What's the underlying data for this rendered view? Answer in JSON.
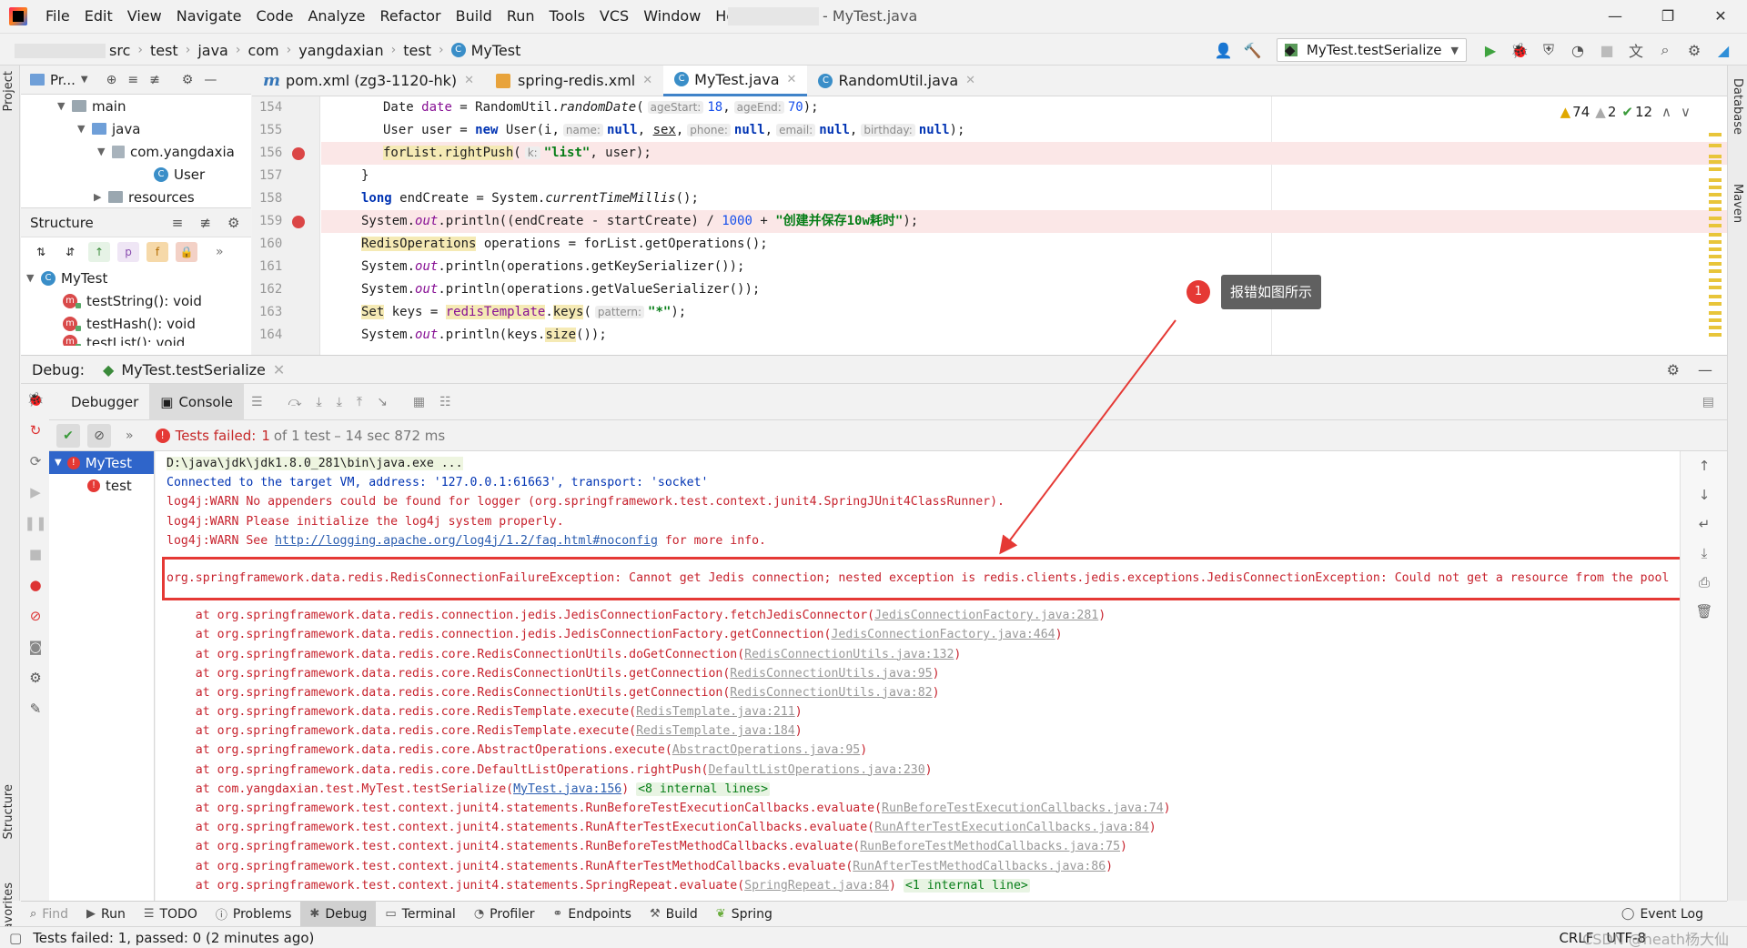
{
  "app": {
    "window_title": "- MyTest.java",
    "menu": [
      "File",
      "Edit",
      "View",
      "Navigate",
      "Code",
      "Analyze",
      "Refactor",
      "Build",
      "Run",
      "Tools",
      "VCS",
      "Window",
      "Help"
    ],
    "window_controls": [
      "—",
      "❐",
      "✕"
    ]
  },
  "breadcrumb": [
    "src",
    "test",
    "java",
    "com",
    "yangdaxian",
    "test",
    "MyTest"
  ],
  "toolbar": {
    "run_config": "MyTest.testSerialize"
  },
  "left_strip": {
    "project": "Project",
    "structure": "Structure",
    "favorites": "Favorites"
  },
  "right_strip": {
    "database": "Database",
    "maven": "Maven"
  },
  "project_panel": {
    "title": "Pr...",
    "tree": [
      {
        "label": "main",
        "level": 2,
        "type": "folder"
      },
      {
        "label": "java",
        "level": 3,
        "type": "folder-blue"
      },
      {
        "label": "com.yangdaxia",
        "level": 4,
        "type": "package"
      },
      {
        "label": "User",
        "level": 5,
        "type": "class"
      },
      {
        "label": "resources",
        "level": 3,
        "type": "folder"
      }
    ]
  },
  "structure_panel": {
    "title": "Structure",
    "root": "MyTest",
    "items": [
      "testString(): void",
      "testHash(): void",
      "testList(): void"
    ]
  },
  "editor_tabs": [
    {
      "label": "pom.xml (zg3-1120-hk)",
      "icon": "maven-icon",
      "active": false
    },
    {
      "label": "spring-redis.xml",
      "icon": "xml-icon",
      "active": false
    },
    {
      "label": "MyTest.java",
      "icon": "class-icon",
      "active": true
    },
    {
      "label": "RandomUtil.java",
      "icon": "class-icon",
      "active": false
    }
  ],
  "editor": {
    "line_numbers": [
      "154",
      "155",
      "156",
      "157",
      "158",
      "159",
      "160",
      "161",
      "162",
      "163",
      "164"
    ],
    "inspections": {
      "warnings": "74",
      "weak_warnings": "2",
      "ok": "12"
    },
    "code": {
      "l154": {
        "a": "Date ",
        "b": "date",
        "c": " = RandomUtil.",
        "d": "randomDate",
        "e": "(",
        "h1": "ageStart:",
        "v1": "18",
        "f": ",",
        "h2": "ageEnd:",
        "v2": "70",
        "g": ");"
      },
      "l155": {
        "a": "User user = ",
        "kw": "new",
        "b": " User(i,",
        "h1": "name:",
        "n1": "null",
        "c": ",",
        "sex": "sex",
        "d": ",",
        "h2": "phone:",
        "n2": "null",
        "e": ",",
        "h3": "email:",
        "n3": "null",
        "f": ",",
        "h4": "birthday:",
        "n4": "null",
        "g": ");"
      },
      "l156": {
        "a": "forList.rightPush",
        "b": "(",
        "h1": "k:",
        "s": "\"list\"",
        "c": ", user);"
      },
      "l157": {
        "a": "}"
      },
      "l158": {
        "kw": "long",
        "a": " endCreate = System.",
        "b": "currentTimeMillis",
        "c": "();"
      },
      "l159": {
        "a": "System.",
        "out": "out",
        "b": ".println((endCreate - startCreate) / ",
        "num": "1000",
        "c": " + ",
        "s": "\"创建并保存10w耗时\"",
        "d": ");"
      },
      "l160": {
        "a": "RedisOperations",
        "b": " operations = forList.getOperations();"
      },
      "l161": {
        "a": "System.",
        "out": "out",
        "b": ".println(operations.getKeySerializer());"
      },
      "l162": {
        "a": "System.",
        "out": "out",
        "b": ".println(operations.getValueSerializer());"
      },
      "l163": {
        "a": "Set",
        "b": " keys = ",
        "c": "redisTemplate",
        "d": ".",
        "e": "keys",
        "f": "(",
        "h1": "pattern:",
        "s": "\"*\"",
        "g": ");"
      },
      "l164": {
        "a": "System.",
        "out": "out",
        "b": ".println(keys.",
        "c": "size",
        "d": "());"
      }
    }
  },
  "annotation": {
    "number": "1",
    "text": "报错如图所示"
  },
  "debug": {
    "label": "Debug:",
    "session": "MyTest.testSerialize",
    "tabs": [
      "Debugger",
      "Console"
    ],
    "status": {
      "prefix": "Tests failed:",
      "failed": "1",
      "of": "of 1 test",
      "time": "– 14 sec 872 ms"
    },
    "test_tree": [
      "MyTest",
      "test"
    ]
  },
  "console": {
    "l1": "D:\\java\\jdk\\jdk1.8.0_281\\bin\\java.exe ...",
    "l2": "Connected to the target VM, address: '127.0.0.1:61663', transport: 'socket'",
    "l3": "log4j:WARN No appenders could be found for logger (org.springframework.test.context.junit4.SpringJUnit4ClassRunner).",
    "l4": "log4j:WARN Please initialize the log4j system properly.",
    "l5a": "log4j:WARN See ",
    "l5link": "http://logging.apache.org/log4j/1.2/faq.html#noconfig",
    "l5b": " for more info.",
    "exception": "org.springframework.data.redis.RedisConnectionFailureException: Cannot get Jedis connection; nested exception is redis.clients.jedis.exceptions.JedisConnectionException: Could not get a resource from the pool",
    "trace": [
      {
        "at": "    at org.springframework.data.redis.connection.jedis.JedisConnectionFactory.fetchJedisConnector(",
        "link": "JedisConnectionFactory.java:281",
        "end": ")"
      },
      {
        "at": "    at org.springframework.data.redis.connection.jedis.JedisConnectionFactory.getConnection(",
        "link": "JedisConnectionFactory.java:464",
        "end": ")"
      },
      {
        "at": "    at org.springframework.data.redis.core.RedisConnectionUtils.doGetConnection(",
        "link": "RedisConnectionUtils.java:132",
        "end": ")"
      },
      {
        "at": "    at org.springframework.data.redis.core.RedisConnectionUtils.getConnection(",
        "link": "RedisConnectionUtils.java:95",
        "end": ")"
      },
      {
        "at": "    at org.springframework.data.redis.core.RedisConnectionUtils.getConnection(",
        "link": "RedisConnectionUtils.java:82",
        "end": ")"
      },
      {
        "at": "    at org.springframework.data.redis.core.RedisTemplate.execute(",
        "link": "RedisTemplate.java:211",
        "end": ")"
      },
      {
        "at": "    at org.springframework.data.redis.core.RedisTemplate.execute(",
        "link": "RedisTemplate.java:184",
        "end": ")"
      },
      {
        "at": "    at org.springframework.data.redis.core.AbstractOperations.execute(",
        "link": "AbstractOperations.java:95",
        "end": ")"
      },
      {
        "at": "    at org.springframework.data.redis.core.DefaultListOperations.rightPush(",
        "link": "DefaultListOperations.java:230",
        "end": ")"
      },
      {
        "at": "    at com.yangdaxian.test.MyTest.testSerialize(",
        "link": "MyTest.java:156",
        "end": ")",
        "collapsed": "<8 internal lines>",
        "own": true
      },
      {
        "at": "    at org.springframework.test.context.junit4.statements.RunBeforeTestExecutionCallbacks.evaluate(",
        "link": "RunBeforeTestExecutionCallbacks.java:74",
        "end": ")"
      },
      {
        "at": "    at org.springframework.test.context.junit4.statements.RunAfterTestExecutionCallbacks.evaluate(",
        "link": "RunAfterTestExecutionCallbacks.java:84",
        "end": ")"
      },
      {
        "at": "    at org.springframework.test.context.junit4.statements.RunBeforeTestMethodCallbacks.evaluate(",
        "link": "RunBeforeTestMethodCallbacks.java:75",
        "end": ")"
      },
      {
        "at": "    at org.springframework.test.context.junit4.statements.RunAfterTestMethodCallbacks.evaluate(",
        "link": "RunAfterTestMethodCallbacks.java:86",
        "end": ")"
      },
      {
        "at": "    at org.springframework.test.context.junit4.statements.SpringRepeat.evaluate(",
        "link": "SpringRepeat.java:84",
        "end": ")",
        "collapsed": "<1 internal line>"
      }
    ]
  },
  "bottom_tools": [
    {
      "label": "Find",
      "icon": "search-icon",
      "dim": true
    },
    {
      "label": "Run",
      "icon": "run-icon"
    },
    {
      "label": "TODO",
      "icon": "list-icon"
    },
    {
      "label": "Problems",
      "icon": "problems-icon"
    },
    {
      "label": "Debug",
      "icon": "bug-icon",
      "active": true
    },
    {
      "label": "Terminal",
      "icon": "terminal-icon"
    },
    {
      "label": "Profiler",
      "icon": "profiler-icon"
    },
    {
      "label": "Endpoints",
      "icon": "endpoints-icon"
    },
    {
      "label": "Build",
      "icon": "hammer-icon"
    },
    {
      "label": "Spring",
      "icon": "spring-icon"
    }
  ],
  "event_log": "Event Log",
  "status_bar": {
    "message": "Tests failed: 1, passed: 0 (2 minutes ago)",
    "line_sep": "CRLF",
    "encoding": "UTF-8",
    "watermark": "CSDN @heath杨大仙"
  },
  "colors": {
    "accent": "#2f65ca",
    "error": "#e53935",
    "breakpoint": "#db4646"
  }
}
